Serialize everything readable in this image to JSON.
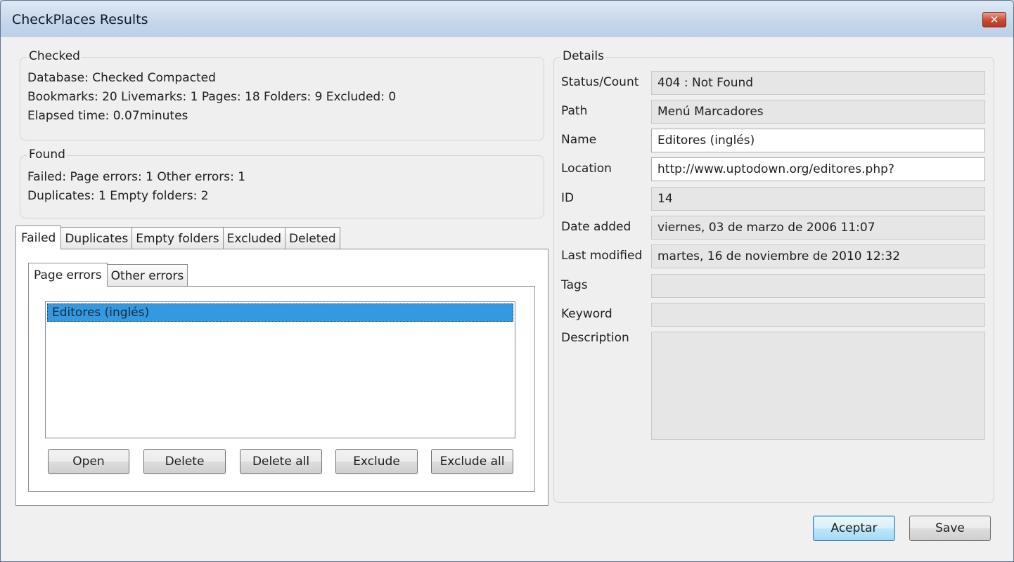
{
  "window": {
    "title": "CheckPlaces Results",
    "close_glyph": "✕"
  },
  "checked": {
    "title": "Checked",
    "database_line": "Database:  Checked  Compacted",
    "counts_line": "Bookmarks: 20   Livemarks: 1   Pages: 18   Folders: 9   Excluded: 0",
    "elapsed_line": "Elapsed time: 0.07minutes"
  },
  "found": {
    "title": "Found",
    "failed_line": "Failed:   Page errors: 1   Other errors: 1",
    "dup_line": "Duplicates: 1   Empty folders: 2"
  },
  "tabs": [
    "Failed",
    "Duplicates",
    "Empty folders",
    "Excluded",
    "Deleted"
  ],
  "subtabs": [
    "Page errors",
    "Other errors"
  ],
  "list": {
    "items": [
      "Editores (inglés)"
    ]
  },
  "buttons": {
    "open": "Open",
    "delete": "Delete",
    "delete_all": "Delete all",
    "exclude": "Exclude",
    "exclude_all": "Exclude all",
    "accept": "Aceptar",
    "save": "Save"
  },
  "details": {
    "title": "Details",
    "status_label": "Status/Count",
    "status_value": "404 : Not Found",
    "path_label": "Path",
    "path_value": "Menú Marcadores",
    "name_label": "Name",
    "name_value": "Editores (inglés)",
    "location_label": "Location",
    "location_value": "http://www.uptodown.org/editores.php?",
    "id_label": "ID",
    "id_value": "14",
    "date_added_label": "Date added",
    "date_added_value": "viernes, 03 de marzo de 2006 11:07",
    "last_modified_label": "Last modified",
    "last_modified_value": "martes, 16 de noviembre de 2010 12:32",
    "tags_label": "Tags",
    "tags_value": "",
    "keyword_label": "Keyword",
    "keyword_value": "",
    "description_label": "Description",
    "description_value": ""
  }
}
